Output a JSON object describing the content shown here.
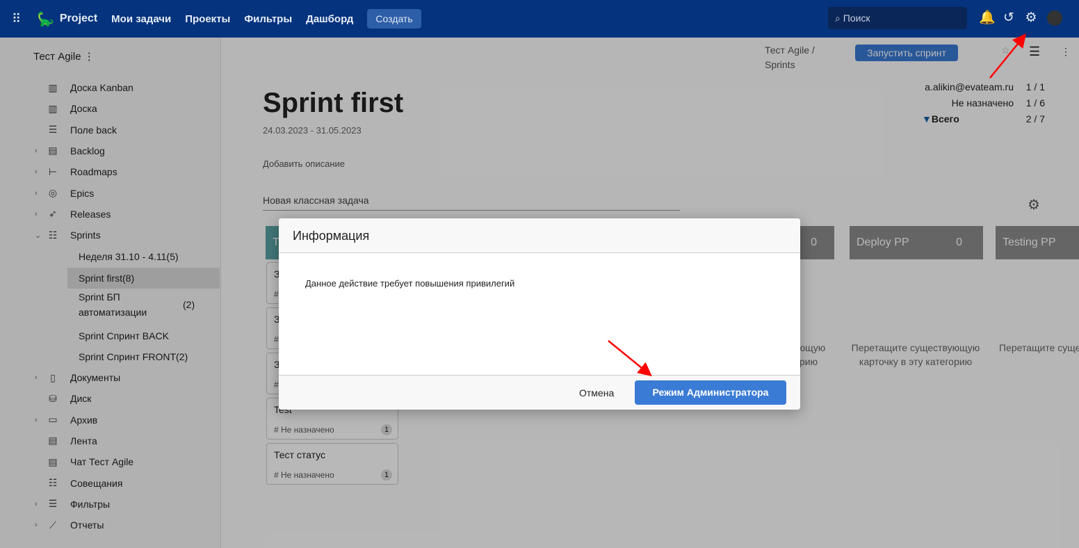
{
  "topbar": {
    "brand": "Project",
    "nav": [
      "Мои задачи",
      "Проекты",
      "Фильтры",
      "Дашборд"
    ],
    "create": "Создать",
    "search_placeholder": "Поиск"
  },
  "sidebar": {
    "project": "Тест Agile",
    "items": [
      {
        "label": "Доска Kanban",
        "icon": "board-icon",
        "chev": false
      },
      {
        "label": "Доска",
        "icon": "board-icon",
        "chev": false
      },
      {
        "label": "Поле back",
        "icon": "filter-lines-icon",
        "chev": false
      },
      {
        "label": "Backlog",
        "icon": "backlog-icon",
        "chev": true
      },
      {
        "label": "Roadmaps",
        "icon": "roadmap-icon",
        "chev": true
      },
      {
        "label": "Epics",
        "icon": "target-icon",
        "chev": true
      },
      {
        "label": "Releases",
        "icon": "rocket-icon",
        "chev": true
      },
      {
        "label": "Sprints",
        "icon": "checklist-icon",
        "chev": true,
        "open": true
      }
    ],
    "sprints": [
      "Неделя 31.10 - 4.11(5)",
      "Sprint first(8)",
      "Sprint БП автоматизации",
      "Sprint Спринт BACK",
      "Sprint Спринт FRONT(2)"
    ],
    "sprint_bp_count": "(2)",
    "items2": [
      {
        "label": "Документы",
        "icon": "document-icon",
        "chev": true
      },
      {
        "label": "Диск",
        "icon": "disk-icon",
        "chev": false
      },
      {
        "label": "Архив",
        "icon": "archive-icon",
        "chev": true
      },
      {
        "label": "Лента",
        "icon": "feed-icon",
        "chev": false
      },
      {
        "label": "Чат Тест Agile",
        "icon": "chat-icon",
        "chev": false
      },
      {
        "label": "Совещания",
        "icon": "checklist-icon",
        "chev": false
      },
      {
        "label": "Фильтры",
        "icon": "filter-lines-icon",
        "chev": true
      },
      {
        "label": "Отчеты",
        "icon": "chart-icon",
        "chev": true
      }
    ]
  },
  "main": {
    "breadcrumb": "Тест Agile /",
    "breadcrumb2": "Sprints",
    "start_sprint": "Запустить спринт",
    "title": "Sprint first",
    "dates": "24.03.2023 - 31.05.2023",
    "add_desc": "Добавить описание",
    "new_task_placeholder": "Новая классная задача",
    "stats": [
      {
        "name": "a.alikin@evateam.ru",
        "val": "1 / 1"
      },
      {
        "name": "Не назначено",
        "val": "1 / 6"
      },
      {
        "name": "Всего",
        "val": "2 / 7"
      }
    ],
    "columns": [
      {
        "name": "Т",
        "count": ""
      },
      {
        "name": "",
        "count": "0"
      },
      {
        "name": "Deploy PP",
        "count": "0"
      },
      {
        "name": "Testing PP",
        "count": ""
      }
    ],
    "placeholder": "Перетащите существующую карточку в эту категорию",
    "cards": [
      {
        "title": "З",
        "meta": "#",
        "count": ""
      },
      {
        "title": "З",
        "meta": "#",
        "count": ""
      },
      {
        "title": "З",
        "meta": "#",
        "count": ""
      },
      {
        "title": "Test",
        "meta": "# Не назначено",
        "count": "1"
      },
      {
        "title": "Тест статус",
        "meta": "# Не назначено",
        "count": "1"
      }
    ]
  },
  "modal": {
    "title": "Информация",
    "message": "Данное действие требует повышения привилегий",
    "cancel": "Отмена",
    "confirm": "Режим Администратора"
  },
  "colors": {
    "topbar": "#05337d",
    "primary": "#3a7bd5",
    "arrow": "#ff0000"
  }
}
